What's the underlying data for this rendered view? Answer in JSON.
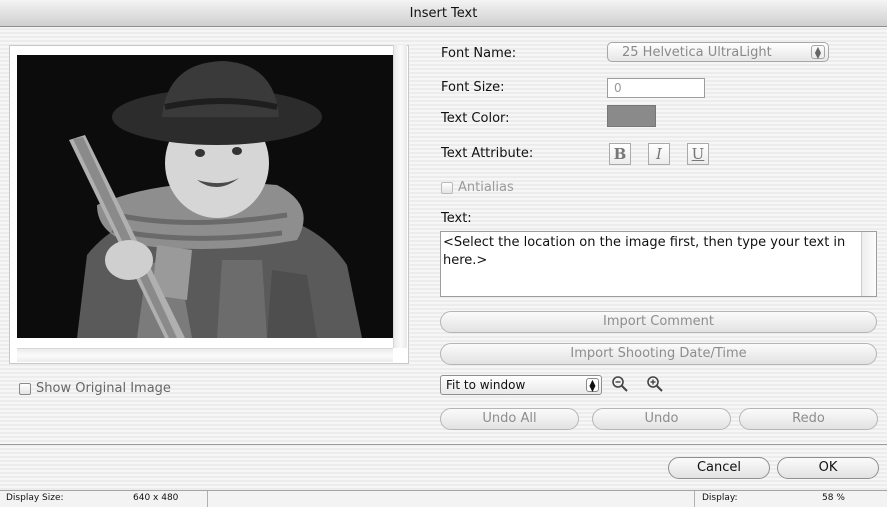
{
  "window": {
    "title": "Insert Text"
  },
  "preview": {
    "show_original_label": "Show Original Image"
  },
  "form": {
    "font_name_label": "Font Name:",
    "font_name_value": "25 Helvetica UltraLight",
    "font_size_label": "Font Size:",
    "font_size_value": "0",
    "text_color_label": "Text Color:",
    "text_color_value": "#8a8a8a",
    "text_attribute_label": "Text Attribute:",
    "bold_label": "B",
    "italic_label": "I",
    "underline_label": "U",
    "antialias_label": "Antialias",
    "text_label": "Text:",
    "text_value": "<Select the location on the image first, then type your text in here.>"
  },
  "buttons": {
    "import_comment": "Import Comment",
    "import_date": "Import Shooting Date/Time",
    "undo_all": "Undo All",
    "undo": "Undo",
    "redo": "Redo",
    "cancel": "Cancel",
    "ok": "OK"
  },
  "zoom": {
    "selected": "Fit to window"
  },
  "status": {
    "display_size_label": "Display Size:",
    "display_size_value": "640 x 480",
    "display_label": "Display:",
    "display_value": "58 %"
  }
}
